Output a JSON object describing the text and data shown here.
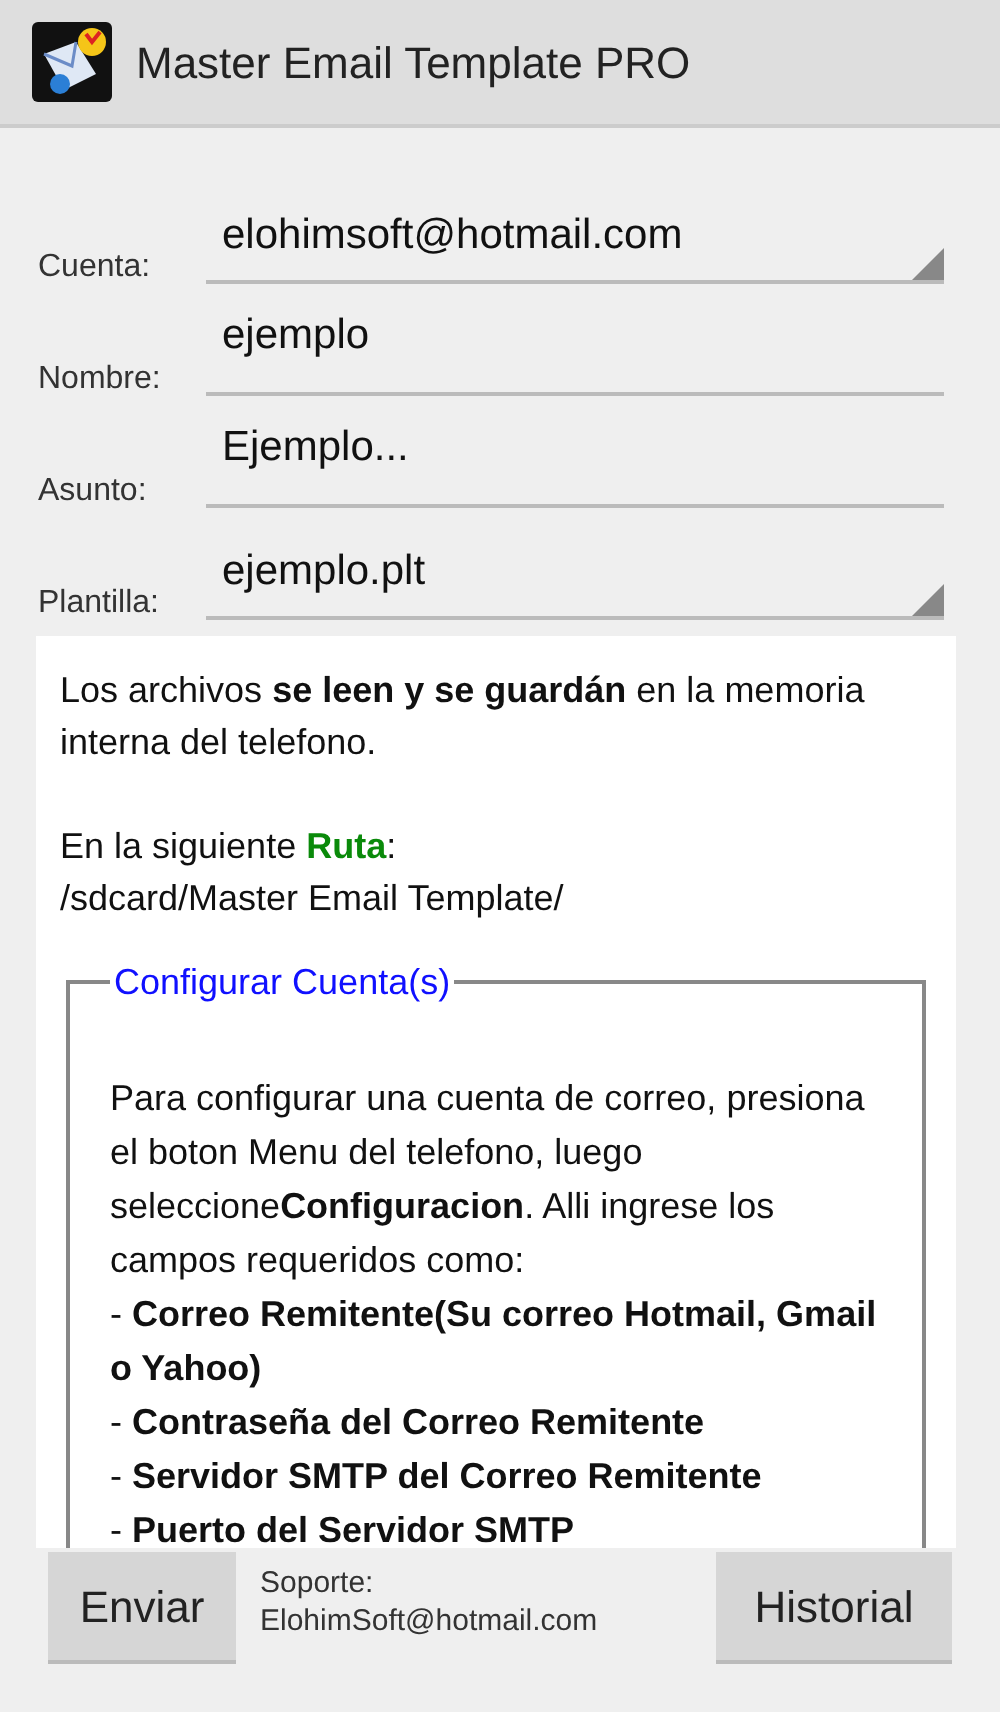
{
  "window": {
    "title": "Master Email Template PRO"
  },
  "fields": [
    {
      "kind": "spinner",
      "label": "Cuenta:",
      "value": "elohimsoft@hotmail.com"
    },
    {
      "kind": "text",
      "label": "Nombre:",
      "value": "ejemplo"
    },
    {
      "kind": "text",
      "label": "Asunto:",
      "value": "Ejemplo..."
    },
    {
      "kind": "spinner",
      "label": "Plantilla:",
      "value": "ejemplo.plt"
    }
  ],
  "info": {
    "storage_note": "Los archivos **se leen y se guardán** en la memoria interna del telefono.",
    "path_intro": {
      "before": "En la siguiente ",
      "highlight": "Ruta",
      "after": ":"
    },
    "path": "/sdcard/Master Email Template/"
  },
  "account_setup": {
    "legend": "Configurar Cuenta(s)",
    "text": "Para configurar una cuenta de correo, presiona el boton Menu del telefono, luego seleccione**Configuracion**. Alli ingrese los campos requeridos como:",
    "items": [
      "- **Correo Remitente(Su correo Hotmail, Gmail o Yahoo)**",
      "- **Contraseña del Correo Remitente**",
      "- **Servidor SMTP del Correo Remitente**",
      "- **Puerto del Servidor SMTP**"
    ]
  },
  "footer": {
    "send_button": "Enviar",
    "support_label": "Soporte:",
    "support_email": "ElohimSoft@hotmail.com",
    "history_button": "Historial"
  }
}
